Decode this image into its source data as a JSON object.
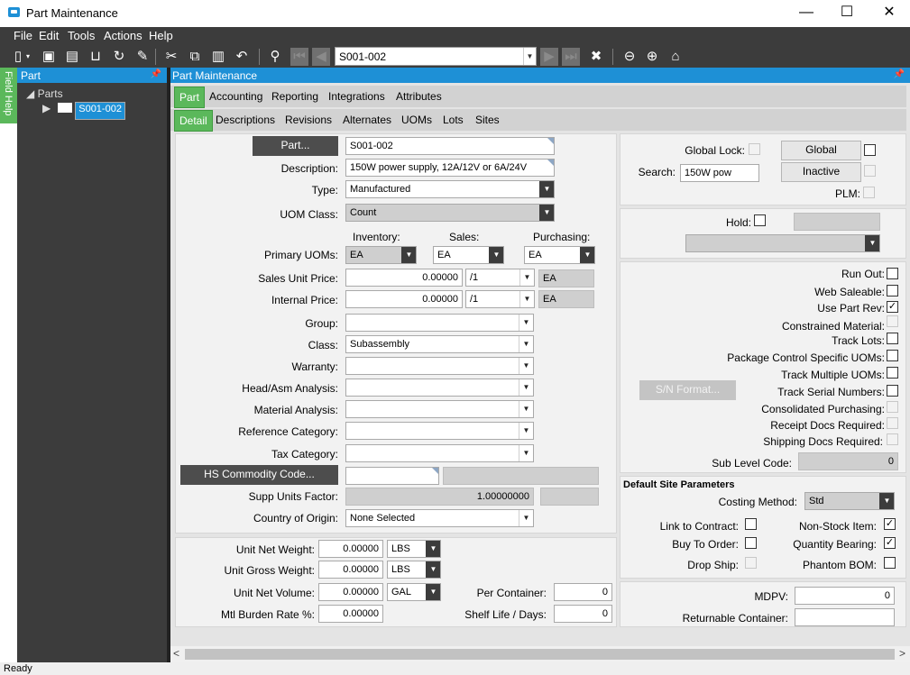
{
  "window": {
    "title": "Part Maintenance",
    "minimize": "—",
    "maximize": "☐",
    "close": "✕"
  },
  "menu": [
    "File",
    "Edit",
    "Tools",
    "Actions",
    "Help"
  ],
  "toolbar": {
    "part_combo": "S001-002"
  },
  "sidebar": {
    "field_help": "Field Help",
    "panel_title": "Part",
    "tree_root": "Parts",
    "tree_item": "S001-002"
  },
  "main": {
    "panel_title": "Part Maintenance",
    "tabs": [
      "Part",
      "Accounting",
      "Reporting",
      "Integrations",
      "Attributes"
    ],
    "subtabs": [
      "Detail",
      "Descriptions",
      "Revisions",
      "Alternates",
      "UOMs",
      "Lots",
      "Sites"
    ]
  },
  "detail": {
    "part_btn": "Part...",
    "part_value": "S001-002",
    "desc_label": "Description:",
    "desc_value": "150W power supply, 12A/12V or 6A/24V",
    "type_label": "Type:",
    "type_value": "Manufactured",
    "uomclass_label": "UOM Class:",
    "uomclass_value": "Count",
    "inv_label": "Inventory:",
    "sales_label": "Sales:",
    "purch_label": "Purchasing:",
    "primary_uoms_label": "Primary UOMs:",
    "inv_uom": "EA",
    "sales_uom": "EA",
    "purch_uom": "EA",
    "sales_price_label": "Sales Unit Price:",
    "sales_price": "0.00000",
    "sales_per": "/1",
    "sales_price_uom": "EA",
    "internal_price_label": "Internal Price:",
    "internal_price": "0.00000",
    "internal_per": "/1",
    "internal_price_uom": "EA",
    "group_label": "Group:",
    "class_label": "Class:",
    "class_value": "Subassembly",
    "warranty_label": "Warranty:",
    "headasm_label": "Head/Asm Analysis:",
    "material_label": "Material Analysis:",
    "refcat_label": "Reference Category:",
    "taxcat_label": "Tax Category:",
    "hs_btn": "HS Commodity Code...",
    "supp_label": "Supp Units Factor:",
    "supp_value": "1.00000000",
    "origin_label": "Country of Origin:",
    "origin_value": "None Selected"
  },
  "weights": {
    "net_weight_label": "Unit Net Weight:",
    "net_weight": "0.00000",
    "net_weight_uom": "LBS",
    "gross_weight_label": "Unit Gross Weight:",
    "gross_weight": "0.00000",
    "gross_weight_uom": "LBS",
    "net_volume_label": "Unit Net Volume:",
    "net_volume": "0.00000",
    "net_volume_uom": "GAL",
    "burden_label": "Mtl Burden Rate %:",
    "burden": "0.00000",
    "per_container_label": "Per Container:",
    "per_container": "0",
    "shelf_life_label": "Shelf Life / Days:",
    "shelf_life": "0"
  },
  "right": {
    "global_lock_label": "Global Lock:",
    "global_btn": "Global",
    "search_label": "Search:",
    "search_value": "150W pow",
    "inactive_btn": "Inactive",
    "plm_label": "PLM:",
    "hold_label": "Hold:",
    "run_out": "Run Out:",
    "web_saleable": "Web Saleable:",
    "use_part_rev": "Use Part Rev:",
    "constrained": "Constrained Material:",
    "track_lots": "Track Lots:",
    "pkg_control": "Package Control Specific UOMs:",
    "track_multi": "Track Multiple UOMs:",
    "sn_btn": "S/N Format...",
    "track_serial": "Track Serial Numbers:",
    "consolidated": "Consolidated Purchasing:",
    "receipt_docs": "Receipt Docs Required:",
    "shipping_docs": "Shipping Docs Required:",
    "sub_level_label": "Sub Level Code:",
    "sub_level": "0",
    "site_section": "Default Site Parameters",
    "costing_label": "Costing Method:",
    "costing_value": "Std",
    "link_contract": "Link to Contract:",
    "non_stock": "Non-Stock Item:",
    "buy_to_order": "Buy To Order:",
    "qty_bearing": "Quantity Bearing:",
    "drop_ship": "Drop Ship:",
    "phantom": "Phantom BOM:",
    "mdpv_label": "MDPV:",
    "mdpv": "0",
    "returnable_label": "Returnable Container:"
  },
  "status": "Ready",
  "colors": {
    "accent": "#1e90d6",
    "active_tab": "#5bb85b",
    "chrome": "#3c3c3c"
  }
}
